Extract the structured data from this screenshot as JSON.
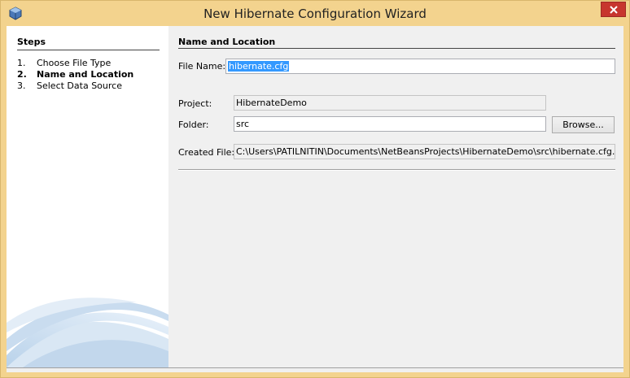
{
  "window": {
    "title": "New Hibernate Configuration Wizard"
  },
  "steps": {
    "heading": "Steps",
    "items": [
      {
        "num": "1.",
        "label": "Choose File Type"
      },
      {
        "num": "2.",
        "label": "Name and Location"
      },
      {
        "num": "3.",
        "label": "Select Data Source"
      }
    ],
    "current_index": 1
  },
  "form": {
    "heading": "Name and Location",
    "file_name_label": "File Name:",
    "file_name_value": "hibernate.cfg",
    "project_label": "Project:",
    "project_value": "HibernateDemo",
    "folder_label": "Folder:",
    "folder_value": "src",
    "browse_label": "Browse...",
    "created_file_label": "Created File:",
    "created_file_value": "C:\\Users\\PATILNITIN\\Documents\\NetBeansProjects\\HibernateDemo\\src\\hibernate.cfg.xml"
  },
  "colors": {
    "titlebar": "#f3d38e",
    "close_button": "#c7352e",
    "selection": "#3399ff"
  },
  "icons": [
    "app-icon",
    "close-icon"
  ]
}
